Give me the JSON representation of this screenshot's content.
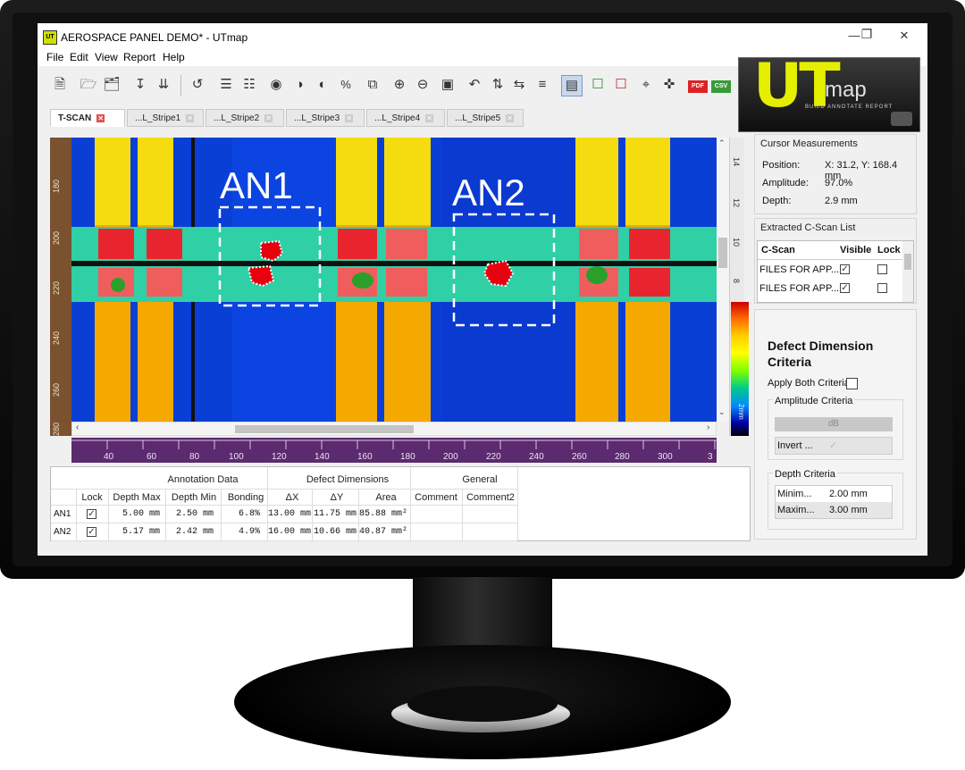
{
  "window": {
    "title": "AEROSPACE PANEL DEMO* - UTmap",
    "app_icon": "utmap-app-icon",
    "controls": [
      "minimize-icon",
      "restore-icon",
      "close-icon"
    ]
  },
  "menu": [
    "File",
    "Edit",
    "View",
    "Report",
    "Help"
  ],
  "toolbar": {
    "icons": [
      "new-project-icon",
      "open-folder-icon",
      "open-recent-icon",
      "import-icon",
      "import-multiple-icon",
      "rotate-scan-icon",
      "layers-add-icon",
      "layers-remove-icon",
      "palette-icon",
      "palette-edit-icon",
      "palette-settings-icon",
      "percent-icon",
      "copy-icon",
      "zoom-in-icon",
      "zoom-out-icon",
      "fit-icon",
      "rotate-left-icon",
      "flip-vertical-icon",
      "flip-horizontal-icon",
      "align-icon",
      "view-toggle-icon",
      "annotation-add-icon",
      "annotation-remove-icon",
      "crop-icon",
      "cursor-crosshair-icon",
      "export-pdf-icon",
      "export-csv-icon"
    ],
    "pdf_label": "PDF",
    "csv_label": "CSV"
  },
  "logo": {
    "ut": "UT",
    "map": "map",
    "tagline": "BUILD ANNOTATE REPORT"
  },
  "tabs": [
    {
      "label": "T-SCAN",
      "active": true
    },
    {
      "label": "...L_Stripe1",
      "active": false
    },
    {
      "label": "...L_Stripe2",
      "active": false
    },
    {
      "label": "...L_Stripe3",
      "active": false
    },
    {
      "label": "...L_Stripe4",
      "active": false
    },
    {
      "label": "...L_Stripe5",
      "active": false
    }
  ],
  "scan": {
    "annotations": [
      {
        "label": "AN1"
      },
      {
        "label": "AN2"
      }
    ],
    "left_ruler_ticks": [
      "180",
      "200",
      "220",
      "240",
      "260",
      "280"
    ],
    "bottom_ruler_ticks": [
      "40",
      "60",
      "80",
      "100",
      "120",
      "140",
      "160",
      "180",
      "200",
      "220",
      "240",
      "260",
      "280",
      "300",
      "3"
    ],
    "right_ruler_ticks": [
      "14",
      "12",
      "10",
      "8"
    ],
    "colorbar_label": "2mm"
  },
  "cursor_measurements": {
    "title": "Cursor Measurements",
    "position_label": "Position:",
    "position_value": "X: 31.2, Y: 168.4 mm",
    "amplitude_label": "Amplitude:",
    "amplitude_value": "97.0%",
    "depth_label": "Depth:",
    "depth_value": "2.9 mm"
  },
  "cscan_list": {
    "title": "Extracted C-Scan List",
    "headers": [
      "C-Scan",
      "Visible",
      "Lock"
    ],
    "rows": [
      {
        "name": "FILES FOR APP...",
        "visible": true,
        "lock": false
      },
      {
        "name": "FILES FOR APP...",
        "visible": true,
        "lock": false
      }
    ]
  },
  "criteria": {
    "title_line1": "Defect Dimension",
    "title_line2": "Criteria",
    "apply_both_label": "Apply Both Criteria",
    "amplitude_title": "Amplitude Criteria",
    "db_label": "dB",
    "invert_label": "Invert ...",
    "depth_title": "Depth Criteria",
    "min_label": "Minim...",
    "min_value": "2.00 mm",
    "max_label": "Maxim...",
    "max_value": "3.00 mm"
  },
  "table": {
    "groups": [
      "Annotation Data",
      "Defect Dimensions",
      "General"
    ],
    "columns": [
      "Lock",
      "Depth Max",
      "Depth Min",
      "Bonding",
      "ΔX",
      "ΔY",
      "Area",
      "Comment",
      "Comment2"
    ],
    "rows": [
      {
        "id": "AN1",
        "lock": true,
        "depth_max": "5.00 mm",
        "depth_min": "2.50 mm",
        "bonding": "6.8%",
        "dx": "13.00 mm",
        "dy": "11.75 mm",
        "area": "85.88 mm²",
        "comment": "",
        "comment2": ""
      },
      {
        "id": "AN2",
        "lock": true,
        "depth_max": "5.17 mm",
        "depth_min": "2.42 mm",
        "bonding": "4.9%",
        "dx": "16.00 mm",
        "dy": "10.66 mm",
        "area": "40.87 mm²",
        "comment": "",
        "comment2": ""
      }
    ]
  }
}
